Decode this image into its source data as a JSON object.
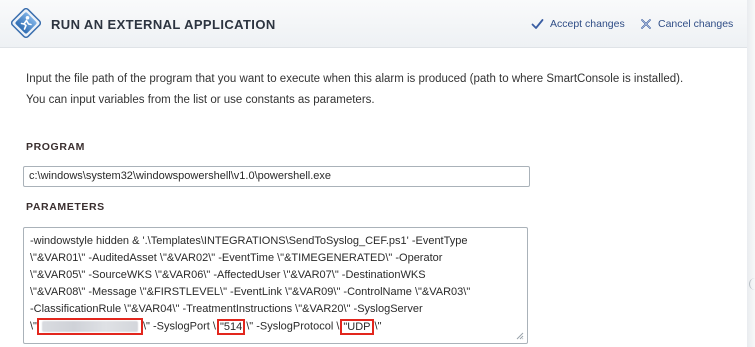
{
  "header": {
    "title_first": "R",
    "title_rest_1": "un an ",
    "title_cap_2": "E",
    "title_rest_2": "xternal ",
    "title_cap_3": "A",
    "title_rest_3": "pplication",
    "accept_label": "Accept changes",
    "cancel_label": "Cancel changes"
  },
  "description": {
    "line1": "Input the file path of the program that you want to execute when this alarm is produced (path to where SmartConsole is installed).",
    "line2": "You can input variables from the list or use constants as parameters."
  },
  "program": {
    "label": "Program",
    "value": "c:\\windows\\system32\\windowspowershell\\v1.0\\powershell.exe"
  },
  "parameters": {
    "label": "Parameters",
    "lines": [
      "-windowstyle hidden & '.\\Templates\\INTEGRATIONS\\SendToSyslog_CEF.ps1' -EventType",
      "\\\"&VAR01\\\" -AuditedAsset \\\"&VAR02\\\" -EventTime \\\"&TIMEGENERATED\\\" -Operator",
      "\\\"&VAR05\\\" -SourceWKS \\\"&VAR06\\\" -AffectedUser \\\"&VAR07\\\" -DestinationWKS",
      "\\\"&VAR08\\\" -Message \\\"&FIRSTLEVEL\\\" -EventLink \\\"&VAR09\\\" -ControlName \\\"&VAR03\\\"",
      "-ClassificationRule \\\"&VAR04\\\" -TreatmentInstructions \\\"&VAR20\\\" -SyslogServer"
    ],
    "last_line": {
      "prefix": "\\\"",
      "suffix_1": "\\\" -SyslogPort \\",
      "port_quote": "\"",
      "port": "514",
      "suffix_2": "\\\" -SyslogProtocol \\",
      "proto_quote": "\"",
      "protocol": "UDP",
      "end": "\\\""
    }
  },
  "colors": {
    "accent_link": "#2f4d86",
    "highlight_red": "#e2261d"
  }
}
